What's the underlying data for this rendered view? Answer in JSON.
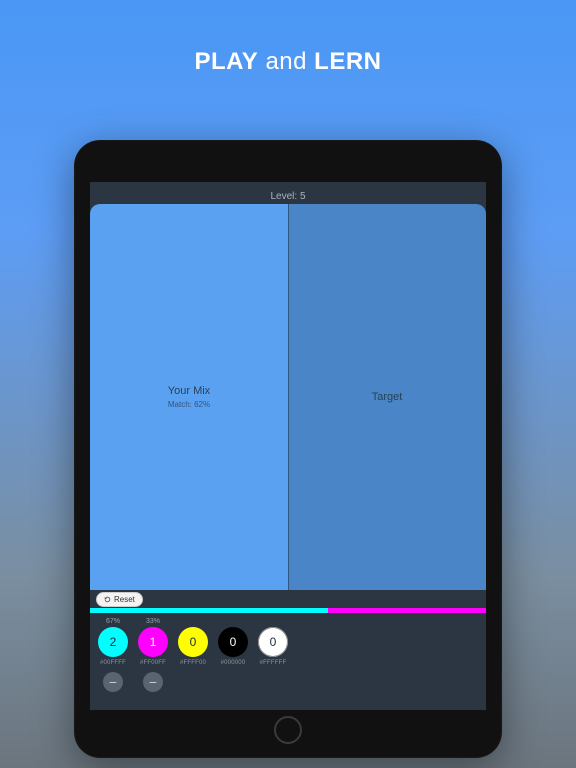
{
  "headline": {
    "strong1": "PLAY",
    "mid": " and ",
    "strong2": "LERN"
  },
  "topbar": {
    "level_label": "Level: 5"
  },
  "panels": {
    "left": {
      "title": "Your Mix",
      "match": "Match: 62%",
      "color": "#5aa1f2"
    },
    "right": {
      "title": "Target",
      "color": "#4a86c7"
    }
  },
  "reset": {
    "label": "Reset"
  },
  "stripe": {
    "cyan_pct": 60,
    "magenta_pct": 40
  },
  "swatches": [
    {
      "pct": "67%",
      "count": "2",
      "hex": "#00FFFF",
      "fill": "#00FFFF",
      "text": "#1b2a38",
      "has_minus": true
    },
    {
      "pct": "33%",
      "count": "1",
      "hex": "#FF00FF",
      "fill": "#FF00FF",
      "text": "#ffffff",
      "has_minus": true
    },
    {
      "pct": "",
      "count": "0",
      "hex": "#FFFF00",
      "fill": "#FFFF00",
      "text": "#1b2a38",
      "has_minus": false
    },
    {
      "pct": "",
      "count": "0",
      "hex": "#000000",
      "fill": "#000000",
      "text": "#ffffff",
      "has_minus": false
    },
    {
      "pct": "",
      "count": "0",
      "hex": "#FFFFFF",
      "fill": "#FFFFFF",
      "text": "#1b2a38",
      "has_minus": false
    }
  ]
}
